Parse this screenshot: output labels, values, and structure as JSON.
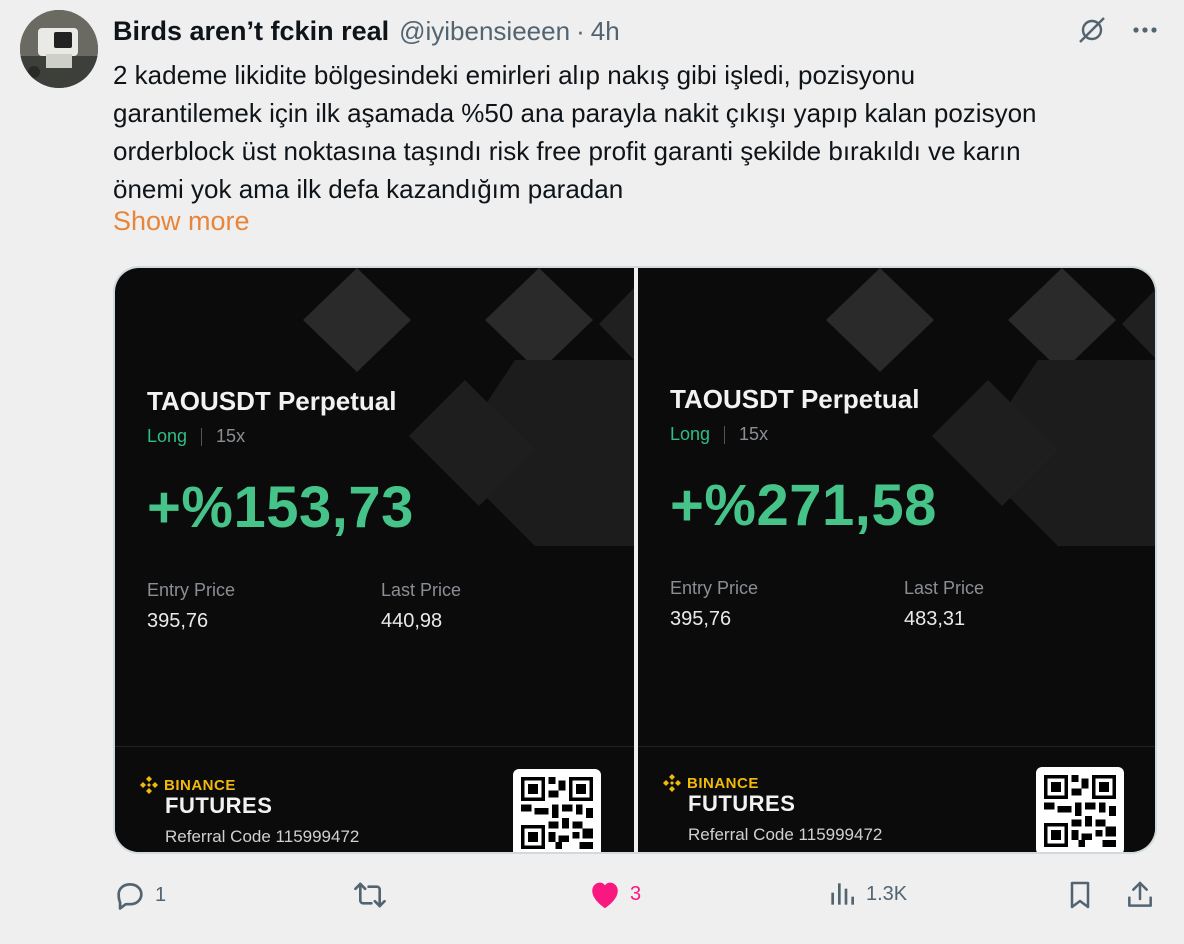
{
  "author": {
    "display_name": "Birds aren’t fckin real",
    "handle": "@iyibensieeen",
    "separator": "·",
    "time": "4h"
  },
  "tweet": {
    "lines": [
      "2 kademe likidite bölgesindeki emirleri alıp nakış gibi işledi, pozisyonu",
      "garantilemek için ilk aşamada %50 ana parayla nakit çıkışı yapıp kalan pozisyon",
      "orderblock üst noktasına taşındı risk free profit garanti şekilde bırakıldı ve karın",
      "önemi yok ama ilk defa kazandığım paradan"
    ],
    "show_more": "Show more"
  },
  "cards": [
    {
      "pair": "TAOUSDT Perpetual",
      "side": "Long",
      "leverage": "15x",
      "pnl": "+%153,73",
      "entry_label": "Entry Price",
      "entry_value": "395,76",
      "last_label": "Last Price",
      "last_value": "440,98",
      "brand_top": "BINANCE",
      "brand_bottom": "FUTURES",
      "referral": "Referral Code 115999472"
    },
    {
      "pair": "TAOUSDT Perpetual",
      "side": "Long",
      "leverage": "15x",
      "pnl": "+%271,58",
      "entry_label": "Entry Price",
      "entry_value": "395,76",
      "last_label": "Last Price",
      "last_value": "483,31",
      "brand_top": "BINANCE",
      "brand_bottom": "FUTURES",
      "referral": "Referral Code 115999472"
    }
  ],
  "actions": {
    "replies": "1",
    "reposts": "",
    "likes": "3",
    "views": "1.3K"
  },
  "icons": {
    "grok": "grok-icon",
    "more": "more-icon",
    "reply": "reply-icon",
    "repost": "repost-icon",
    "like": "heart-icon",
    "views": "views-icon",
    "bookmark": "bookmark-icon",
    "share": "share-icon"
  },
  "colors": {
    "profit": "#45c388",
    "side_long": "#2ebd85",
    "binance": "#f0b90b",
    "show_more": "#e8853a",
    "like": "#f91880"
  }
}
